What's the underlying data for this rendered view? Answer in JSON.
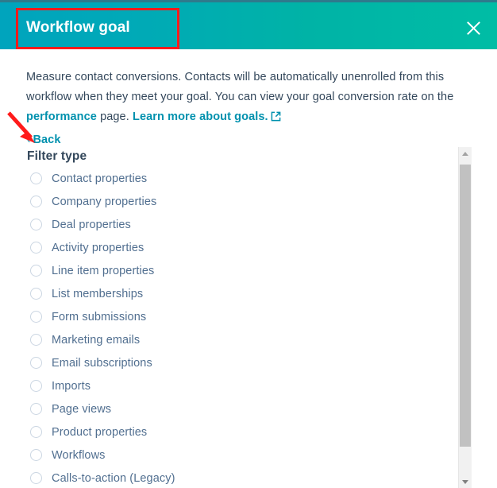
{
  "modal": {
    "title": "Workflow goal",
    "close_icon": "close-icon",
    "header_gradient_start": "#00a4bd",
    "header_gradient_end": "#00bda5"
  },
  "description": {
    "part1": "Measure contact conversions. Contacts will be automatically unenrolled from this workflow when they meet your goal. You can view your goal conversion rate on the ",
    "link_performance": "performance",
    "part2": " page. ",
    "link_learn_more": "Learn more about goals.",
    "external_link_icon": "external-link-icon",
    "link_color": "#0091ae"
  },
  "back": {
    "chevron": "‹",
    "label": "Back"
  },
  "section": {
    "heading": "Filter type"
  },
  "filter_types": [
    {
      "label": "Contact properties",
      "selected": false
    },
    {
      "label": "Company properties",
      "selected": false
    },
    {
      "label": "Deal properties",
      "selected": false
    },
    {
      "label": "Activity properties",
      "selected": false
    },
    {
      "label": "Line item properties",
      "selected": false
    },
    {
      "label": "List memberships",
      "selected": false
    },
    {
      "label": "Form submissions",
      "selected": false
    },
    {
      "label": "Marketing emails",
      "selected": false
    },
    {
      "label": "Email subscriptions",
      "selected": false
    },
    {
      "label": "Imports",
      "selected": false
    },
    {
      "label": "Page views",
      "selected": false
    },
    {
      "label": "Product properties",
      "selected": false
    },
    {
      "label": "Workflows",
      "selected": false
    },
    {
      "label": "Calls-to-action (Legacy)",
      "selected": false
    }
  ],
  "scrollbar": {
    "up_arrow_icon": "caret-up-icon",
    "down_arrow_icon": "caret-down-icon",
    "thumb_icon": "scrollbar-thumb"
  },
  "annotations": {
    "highlight_box_color": "#ff1b1b",
    "arrow_color": "#ff1b1b",
    "arrow_target": "back-link"
  }
}
